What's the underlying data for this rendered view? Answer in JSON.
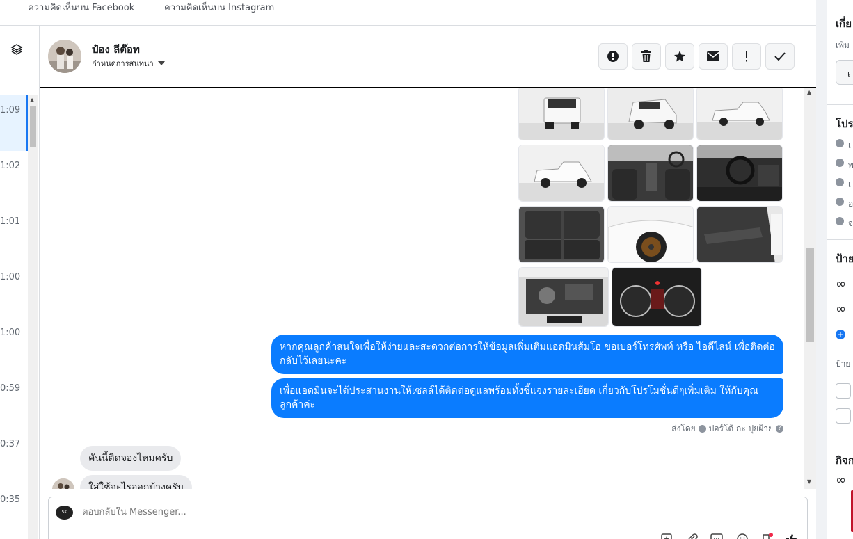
{
  "top_tabs": [
    {
      "label": "ความคิดเห็นบน Facebook"
    },
    {
      "label": "ความคิดเห็นบน Instagram"
    }
  ],
  "conversation_times": [
    "1:09",
    "1:02",
    "1:01",
    "1:00",
    "1:00",
    "0:59",
    "0:37",
    "0:35"
  ],
  "header": {
    "contact_name": "ป๋อง ลีต๊อท",
    "assign_label": "กำหนดการสนทนา"
  },
  "header_actions": [
    {
      "name": "spam-icon"
    },
    {
      "name": "trash-icon"
    },
    {
      "name": "star-icon"
    },
    {
      "name": "envelope-icon"
    },
    {
      "name": "exclamation-icon"
    },
    {
      "name": "check-icon"
    }
  ],
  "messages": {
    "outgoing": [
      "หากคุณลูกค้าสนใจเพื่อให้ง่ายและสะดวกต่อการให้ข้อมูลเพิ่มเติมแอดมินส้มโอ ขอเบอร์โทรศัพท์ หรือ ไอดีไลน์ เพื่อติดต่อกลับไว้เลยนะคะ",
      "เพื่อแอดมินจะได้ประสานงานให้เซลล์ได้ติดต่อดูแลพร้อมทั้งชี้แจงรายละเอียด เกี่ยวกับโปรโมชั่นดีๆเพิ่มเติม ให้กับคุณลูกค้าค่ะ"
    ],
    "sent_by_prefix": "ส่งโดย",
    "sent_by_name": "ปอร์โต้ กะ ปุยฝ้าย",
    "incoming": [
      "คันนี้ติดจองไหมครับ",
      "ใส่ใช้จะไรออกบ้างครับ"
    ]
  },
  "composer": {
    "placeholder": "ตอบกลับใน Messenger...",
    "logo_text": "SK"
  },
  "right_panel": {
    "title_about": "เกี่ย",
    "add_text": "เพิ่ม",
    "btn_text": "เ",
    "title_profile": "โปร",
    "profile_rows": [
      "เ",
      "พ",
      "เ",
      "อ",
      "จ"
    ],
    "title_labels": "ป้าย",
    "labels_sub": "ป้าย",
    "title_activity": "กิจก"
  }
}
